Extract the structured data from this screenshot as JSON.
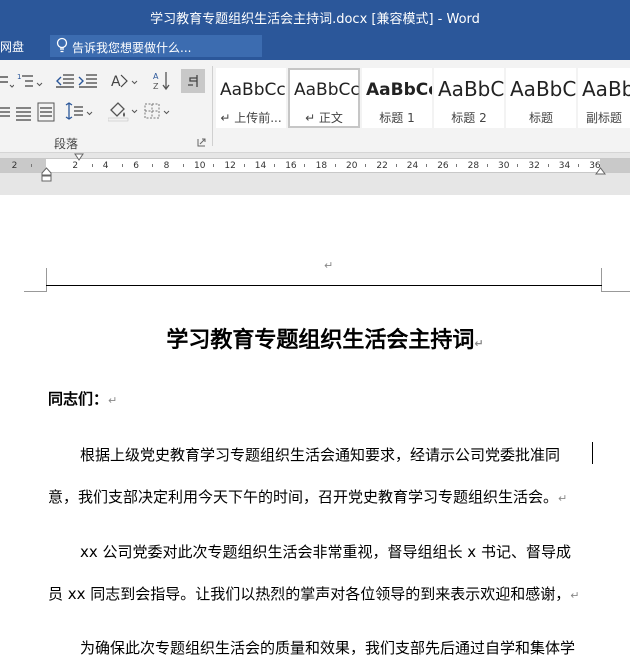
{
  "window": {
    "title": "学习教育专题组织生活会主持词.docx [兼容模式] - Word"
  },
  "tabs": {
    "cut_tab": "百度网盘",
    "tell_me_placeholder": "告诉我您想要做什么..."
  },
  "ribbon": {
    "paragraph_group_label": "段落",
    "styles": [
      {
        "sample": "AaBbCc",
        "name": "↵ 上传前..."
      },
      {
        "sample": "AaBbCc",
        "name": "↵ 正文"
      },
      {
        "sample": "AaBbCc",
        "name": "标题 1"
      },
      {
        "sample": "AaBbC",
        "name": "标题 2"
      },
      {
        "sample": "AaBbC",
        "name": "标题"
      },
      {
        "sample": "AaBb",
        "name": "副标题"
      }
    ]
  },
  "ruler": {
    "labels": [
      "2",
      "2",
      "4",
      "6",
      "8",
      "10",
      "12",
      "14",
      "16",
      "18",
      "20",
      "22",
      "24",
      "26",
      "28",
      "30",
      "32",
      "34",
      "36"
    ]
  },
  "document": {
    "header_mark": "↵",
    "title": "学习教育专题组织生活会主持词",
    "para_mark": "↵",
    "salutation": "同志们：",
    "p1_line1": "根据上级党史教育学习专题组织生活会通知要求，经请示公司党委批准同",
    "p1_line2": "意，我们支部决定利用今天下午的时间，召开党史教育学习专题组织生活会。",
    "p2_line1": "xx 公司党委对此次专题组织生活会非常重视，督导组组长 x 书记、督导成",
    "p2_line2": "员 xx 同志到会指导。让我们以热烈的掌声对各位领导的到来表示欢迎和感谢，",
    "p3_line1": "为确保此次专题组织生活会的质量和效果，我们支部先后通过自学和集体学"
  },
  "colors": {
    "accent": "#2b579a",
    "ribbon_bg": "#f3f3f3",
    "doc_bg": "#ffffff"
  }
}
